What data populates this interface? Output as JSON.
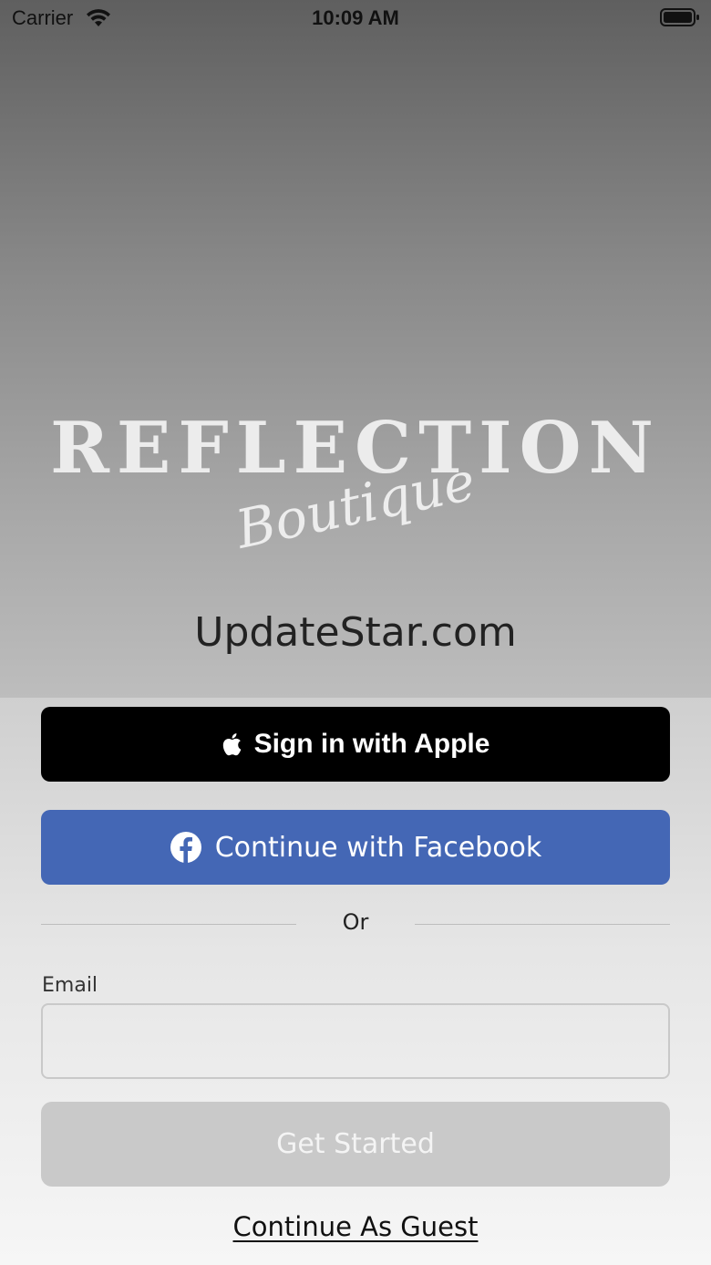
{
  "status_bar": {
    "carrier": "Carrier",
    "time": "10:09 AM",
    "wifi_icon": "wifi-icon",
    "battery_icon": "battery-icon"
  },
  "logo": {
    "main": "REFLECTION",
    "script": "Boutique"
  },
  "brand_text": "UpdateStar.com",
  "auth": {
    "apple_label": "Sign in with Apple",
    "apple_icon": "apple-logo-icon",
    "facebook_label": "Continue with Facebook",
    "facebook_icon": "facebook-logo-icon",
    "divider_text": "Or",
    "email_label": "Email",
    "email_value": "",
    "email_placeholder": "",
    "get_started_label": "Get Started",
    "guest_label": "Continue As Guest"
  },
  "colors": {
    "apple_button": "#000000",
    "facebook_button": "#4467b5",
    "get_started_disabled": "#c9c9c9"
  }
}
